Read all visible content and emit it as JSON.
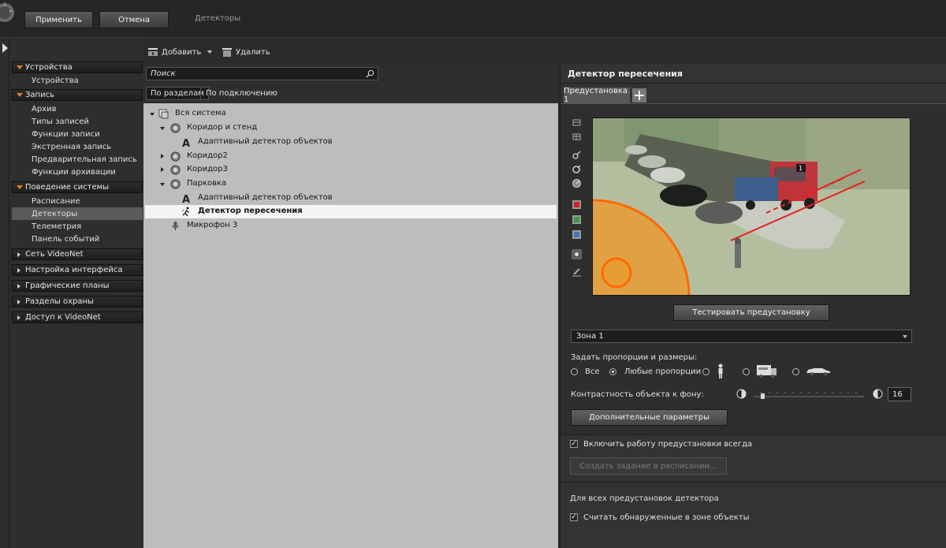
{
  "toolbar": {
    "apply_label": "Применить",
    "cancel_label": "Отмена",
    "title": "Детекторы"
  },
  "nav": {
    "sections": [
      {
        "label": "Устройства",
        "expanded": true,
        "items": [
          "Устройства"
        ]
      },
      {
        "label": "Запись",
        "expanded": true,
        "items": [
          "Архив",
          "Типы записей",
          "Функции записи",
          "Экстренная запись",
          "Предварительная запись",
          "Функции архивации"
        ]
      },
      {
        "label": "Поведение системы",
        "expanded": true,
        "items": [
          "Расписание",
          "Детекторы",
          "Телеметрия",
          "Панель событий"
        ]
      },
      {
        "label": "Сеть VideoNet",
        "expanded": false,
        "items": []
      },
      {
        "label": "Настройка интерфейса",
        "expanded": false,
        "items": []
      },
      {
        "label": "Графические планы",
        "expanded": false,
        "items": []
      },
      {
        "label": "Разделы охраны",
        "expanded": false,
        "items": []
      },
      {
        "label": "Доступ к VideoNet",
        "expanded": false,
        "items": []
      }
    ],
    "selected": "Детекторы"
  },
  "mid_toolbar": {
    "add_label": "Добавить",
    "delete_label": "Удалить"
  },
  "tree": {
    "search_placeholder": "Поиск",
    "tabs": [
      "По разделам",
      "По подключению"
    ],
    "active_tab": 0,
    "rows": [
      {
        "label": "Вся система",
        "level": 0,
        "expander": "down",
        "icon": "system-icon"
      },
      {
        "label": "Коридор и стенд",
        "level": 1,
        "expander": "down",
        "icon": "camera-icon"
      },
      {
        "label": "Адаптивный детектор объектов",
        "level": 2,
        "expander": "",
        "icon": "adaptive-detector-icon"
      },
      {
        "label": "Коридор2",
        "level": 1,
        "expander": "right",
        "icon": "camera-icon"
      },
      {
        "label": "Коридор3",
        "level": 1,
        "expander": "right",
        "icon": "camera-icon"
      },
      {
        "label": "Парковка",
        "level": 1,
        "expander": "down",
        "icon": "camera-icon"
      },
      {
        "label": "Адаптивный детектор объектов",
        "level": 2,
        "expander": "",
        "icon": "adaptive-detector-icon"
      },
      {
        "label": "Детектор пересечения",
        "level": 2,
        "expander": "",
        "icon": "crossing-detector-icon",
        "selected": true
      },
      {
        "label": "Микрофон 3",
        "level": 1,
        "expander": "",
        "icon": "microphone-icon"
      }
    ]
  },
  "detector": {
    "title": "Детектор пересечения",
    "preset_tab": "Предустановка 1",
    "camera_overlay_number": "1",
    "test_button": "Тестировать предустановку",
    "zone_value": "Зона 1",
    "proportions_label": "Задать пропорции и размеры:",
    "radio_all": "Все",
    "radio_any": "Любые пропорции",
    "selected_radio": "any",
    "contrast_label": "Контрастность объекта к фону:",
    "contrast_value": "16",
    "advanced_button": "Дополнительные параметры",
    "enable_always_label": "Включить работу предустановки всегда",
    "enable_always_checked": true,
    "schedule_button": "Создать задание в расписании...",
    "all_presets_label": "Для всех предустановок детектора",
    "count_objects_label": "Считать обнаруженные в зоне объекты",
    "count_objects_checked": true
  },
  "colors": {
    "accent_orange": "#e87a1e",
    "selection_gray": "#5a5a5a",
    "tree_background": "#bdbdbd"
  }
}
